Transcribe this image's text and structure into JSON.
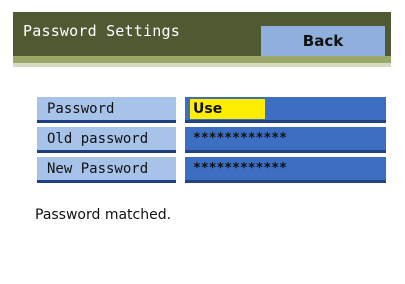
{
  "header": {
    "title": "Password Settings",
    "back_label": "Back"
  },
  "settings": [
    {
      "label": "Password",
      "value": "Use",
      "highlighted": true
    },
    {
      "label": "Old password",
      "value": "************"
    },
    {
      "label": "New Password",
      "value": "************"
    }
  ],
  "status": "Password matched.",
  "colors": {
    "header_bg": "#4f5a33",
    "back_button_bg": "#8fb0dc",
    "label_bg": "#a7c3ea",
    "value_bg": "#3c6fc2",
    "highlight": "#ffee00"
  }
}
